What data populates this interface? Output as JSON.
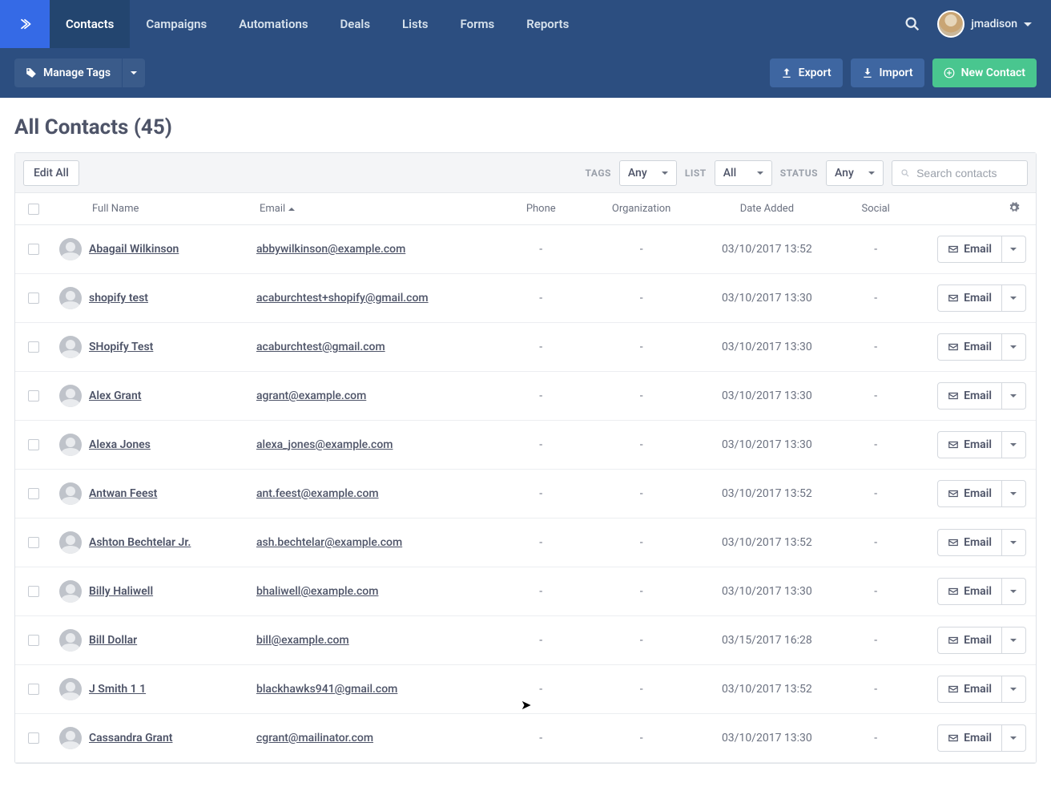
{
  "nav": {
    "tabs": [
      "Contacts",
      "Campaigns",
      "Automations",
      "Deals",
      "Lists",
      "Forms",
      "Reports"
    ],
    "activeIndex": 0,
    "user": "jmadison"
  },
  "toolbar": {
    "manage_tags": "Manage Tags",
    "export": "Export",
    "import": "Import",
    "new_contact": "New Contact"
  },
  "page": {
    "title": "All Contacts (45)"
  },
  "filters": {
    "edit_all": "Edit All",
    "tags_label": "TAGS",
    "tags_value": "Any",
    "list_label": "LIST",
    "list_value": "All",
    "status_label": "STATUS",
    "status_value": "Any",
    "search_placeholder": "Search contacts"
  },
  "columns": {
    "full_name": "Full Name",
    "email": "Email",
    "phone": "Phone",
    "organization": "Organization",
    "date_added": "Date Added",
    "social": "Social"
  },
  "row_action_label": "Email",
  "contacts": [
    {
      "name": "Abagail Wilkinson",
      "email": "abbywilkinson@example.com",
      "phone": "-",
      "org": "-",
      "date": "03/10/2017 13:52",
      "social": "-"
    },
    {
      "name": "shopify test",
      "email": "acaburchtest+shopify@gmail.com",
      "phone": "-",
      "org": "-",
      "date": "03/10/2017 13:30",
      "social": "-"
    },
    {
      "name": "SHopify Test",
      "email": "acaburchtest@gmail.com",
      "phone": "-",
      "org": "-",
      "date": "03/10/2017 13:30",
      "social": "-"
    },
    {
      "name": "Alex Grant",
      "email": "agrant@example.com",
      "phone": "-",
      "org": "-",
      "date": "03/10/2017 13:30",
      "social": "-"
    },
    {
      "name": "Alexa Jones",
      "email": "alexa_jones@example.com",
      "phone": "-",
      "org": "-",
      "date": "03/10/2017 13:30",
      "social": "-"
    },
    {
      "name": "Antwan Feest",
      "email": "ant.feest@example.com",
      "phone": "-",
      "org": "-",
      "date": "03/10/2017 13:52",
      "social": "-"
    },
    {
      "name": "Ashton Bechtelar Jr.",
      "email": "ash.bechtelar@example.com",
      "phone": "-",
      "org": "-",
      "date": "03/10/2017 13:52",
      "social": "-"
    },
    {
      "name": "Billy Haliwell",
      "email": "bhaliwell@example.com",
      "phone": "-",
      "org": "-",
      "date": "03/10/2017 13:30",
      "social": "-"
    },
    {
      "name": "Bill Dollar",
      "email": "bill@example.com",
      "phone": "-",
      "org": "-",
      "date": "03/15/2017 16:28",
      "social": "-"
    },
    {
      "name": "J Smith 1 1",
      "email": "blackhawks941@gmail.com",
      "phone": "-",
      "org": "-",
      "date": "03/10/2017 13:52",
      "social": "-"
    },
    {
      "name": "Cassandra Grant",
      "email": "cgrant@mailinator.com",
      "phone": "-",
      "org": "-",
      "date": "03/10/2017 13:30",
      "social": "-"
    }
  ]
}
